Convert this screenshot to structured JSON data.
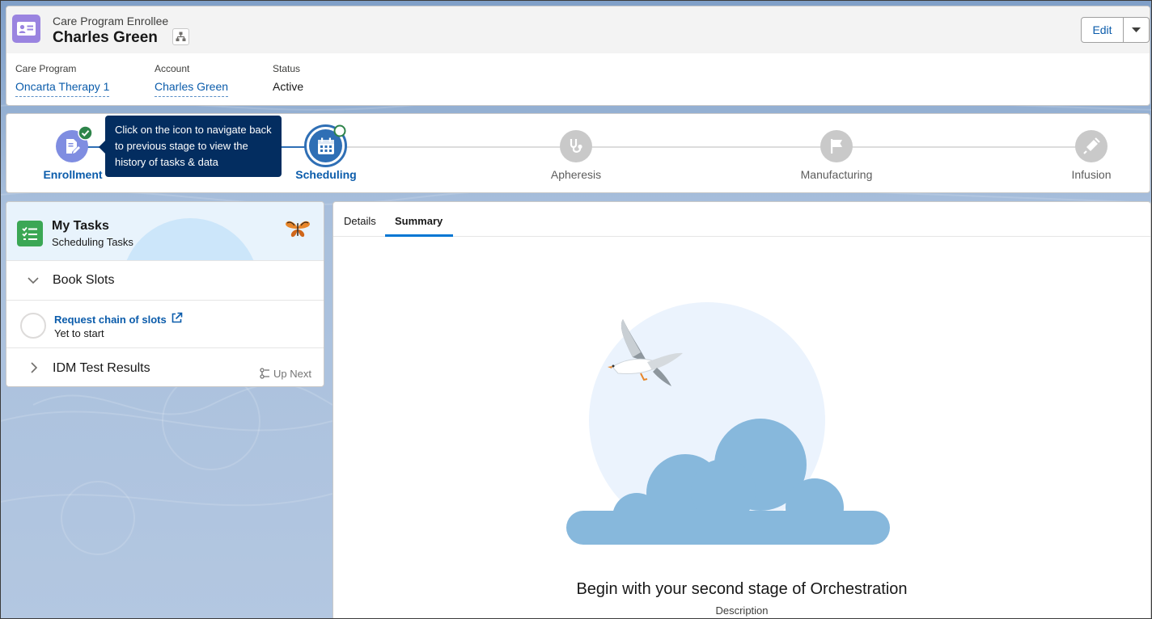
{
  "header": {
    "record_type": "Care Program Enrollee",
    "record_name": "Charles Green",
    "edit_label": "Edit",
    "fields": [
      {
        "label": "Care Program",
        "value": "Oncarta Therapy 1"
      },
      {
        "label": "Account",
        "value": "Charles Green"
      },
      {
        "label": "Status",
        "value": "Active"
      }
    ]
  },
  "path": {
    "tooltip": "Click on the icon to navigate back to previous stage to view the history of tasks & data",
    "stages": [
      {
        "label": "Enrollment",
        "state": "complete",
        "icon": "document-edit-icon"
      },
      {
        "label": "Scheduling",
        "state": "current",
        "icon": "calendar-icon"
      },
      {
        "label": "Apheresis",
        "state": "upcoming",
        "icon": "stethoscope-icon"
      },
      {
        "label": "Manufacturing",
        "state": "upcoming",
        "icon": "flag-icon"
      },
      {
        "label": "Infusion",
        "state": "upcoming",
        "icon": "syringe-icon"
      }
    ],
    "colors": {
      "complete": "#7f8de1",
      "current": "#2f6fb5",
      "upcoming": "#c9c9c9",
      "check": "#2e844a"
    }
  },
  "tasks": {
    "title": "My Tasks",
    "subtitle": "Scheduling Tasks",
    "sections": [
      {
        "label": "Book Slots",
        "expanded": true
      },
      {
        "label": "IDM Test Results",
        "expanded": false,
        "badge": "Up Next"
      }
    ],
    "items": [
      {
        "title": "Request chain of slots",
        "status": "Yet to start"
      }
    ]
  },
  "main": {
    "tabs": [
      {
        "label": "Details",
        "active": false
      },
      {
        "label": "Summary",
        "active": true
      }
    ],
    "empty_title": "Begin with your second stage of Orchestration",
    "empty_description": "Description"
  }
}
